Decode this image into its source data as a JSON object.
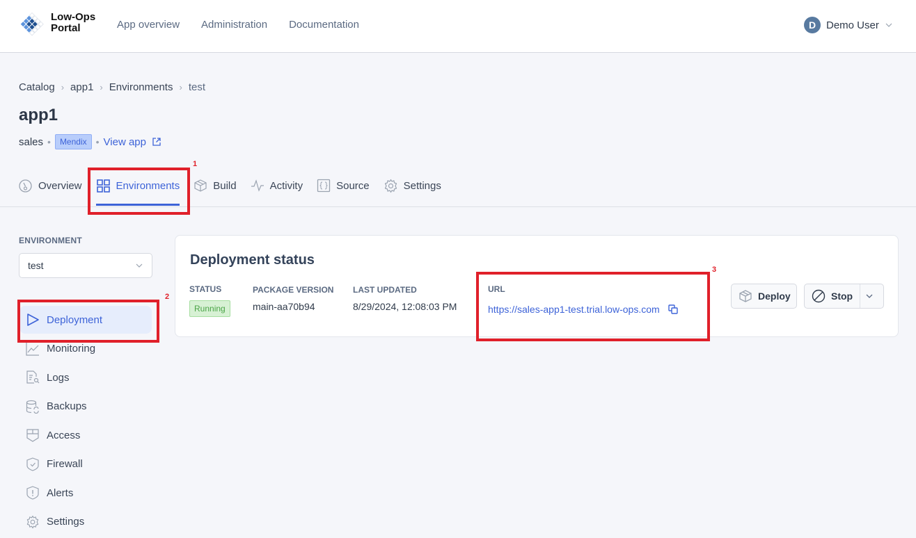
{
  "header": {
    "brand_line1": "Low-Ops",
    "brand_line2": "Portal",
    "nav": [
      "App overview",
      "Administration",
      "Documentation"
    ],
    "user": {
      "initial": "D",
      "name": "Demo User"
    }
  },
  "breadcrumb": [
    "Catalog",
    "app1",
    "Environments",
    "test"
  ],
  "page": {
    "title": "app1",
    "team": "sales",
    "platform_badge": "Mendix",
    "view_app_label": "View app"
  },
  "tabs": [
    {
      "label": "Overview",
      "icon": "gauge-icon",
      "active": false
    },
    {
      "label": "Environments",
      "icon": "grid-icon",
      "active": true
    },
    {
      "label": "Build",
      "icon": "package-icon",
      "active": false
    },
    {
      "label": "Activity",
      "icon": "activity-icon",
      "active": false
    },
    {
      "label": "Source",
      "icon": "braces-icon",
      "active": false
    },
    {
      "label": "Settings",
      "icon": "gear-icon",
      "active": false
    }
  ],
  "sidebar": {
    "environment_label": "ENVIRONMENT",
    "environment_selected": "test",
    "items": [
      {
        "label": "Deployment",
        "icon": "play-icon",
        "active": true
      },
      {
        "label": "Monitoring",
        "icon": "chart-line-icon",
        "active": false
      },
      {
        "label": "Logs",
        "icon": "file-search-icon",
        "active": false
      },
      {
        "label": "Backups",
        "icon": "database-refresh-icon",
        "active": false
      },
      {
        "label": "Access",
        "icon": "shield-grid-icon",
        "active": false
      },
      {
        "label": "Firewall",
        "icon": "shield-check-icon",
        "active": false
      },
      {
        "label": "Alerts",
        "icon": "shield-alert-icon",
        "active": false
      },
      {
        "label": "Settings",
        "icon": "gear-icon",
        "active": false
      }
    ]
  },
  "deployment": {
    "title": "Deployment status",
    "status_label": "STATUS",
    "status_value": "Running",
    "package_label": "PACKAGE VERSION",
    "package_value": "main-aa70b94",
    "updated_label": "LAST UPDATED",
    "updated_value": "8/29/2024, 12:08:03 PM",
    "url_label": "URL",
    "url_value": "https://sales-app1-test.trial.low-ops.com",
    "deploy_label": "Deploy",
    "stop_label": "Stop"
  },
  "annotations": [
    "1",
    "2",
    "3"
  ],
  "colors": {
    "accent": "#3d63d8",
    "annotation": "#e0202a",
    "status_running": "#4aa446"
  }
}
